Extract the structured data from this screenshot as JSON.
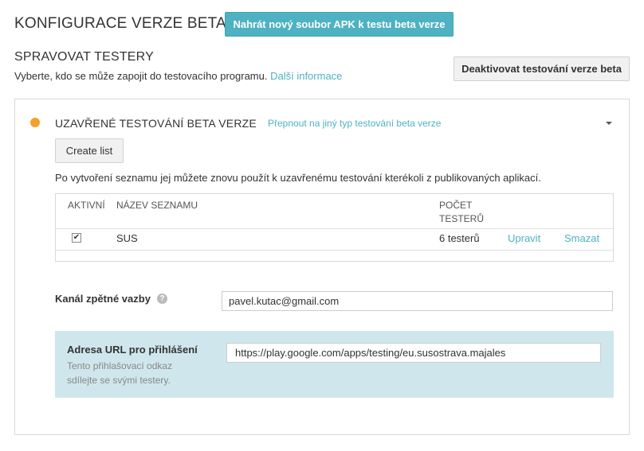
{
  "header": {
    "title": "KONFIGURACE VERZE BETA",
    "upload_label": "Nahrát nový soubor APK k testu beta verze"
  },
  "testers": {
    "title": "SPRAVOVAT TESTERY",
    "description": "Vyberte, kdo se může zapojit do testovacího programu.",
    "more_link": "Další informace",
    "deactivate_label": "Deaktivovat testování verze beta"
  },
  "panel": {
    "status_color": "#f5a02b",
    "title": "UZAVŘENÉ TESTOVÁNÍ BETA VERZE",
    "switch_link": "Přepnout na jiný typ testování beta verze",
    "create_list_label": "Create list",
    "list_note": "Po vytvoření seznamu jej můžete znovu použít k uzavřenému testování kterékoli z publikovaných aplikací.",
    "table": {
      "headers": {
        "active": "AKTIVNÍ",
        "name": "NÁZEV SEZNAMU",
        "count_line1": "POČET",
        "count_line2": "TESTERŮ"
      },
      "rows": [
        {
          "active": true,
          "name": "SUS",
          "count": "6 testerů",
          "edit": "Upravit",
          "delete": "Smazat"
        }
      ]
    },
    "feedback": {
      "label": "Kanál zpětné vazby",
      "value": "pavel.kutac@gmail.com"
    },
    "login_url": {
      "label": "Adresa URL pro přihlášení",
      "sublabel": "Tento přihlašovací odkaz sdílejte se svými testery.",
      "value": "https://play.google.com/apps/testing/eu.susostrava.majales"
    }
  },
  "colors": {
    "accent": "#4eb2c2",
    "url_box_bg": "#cfe7ec"
  }
}
